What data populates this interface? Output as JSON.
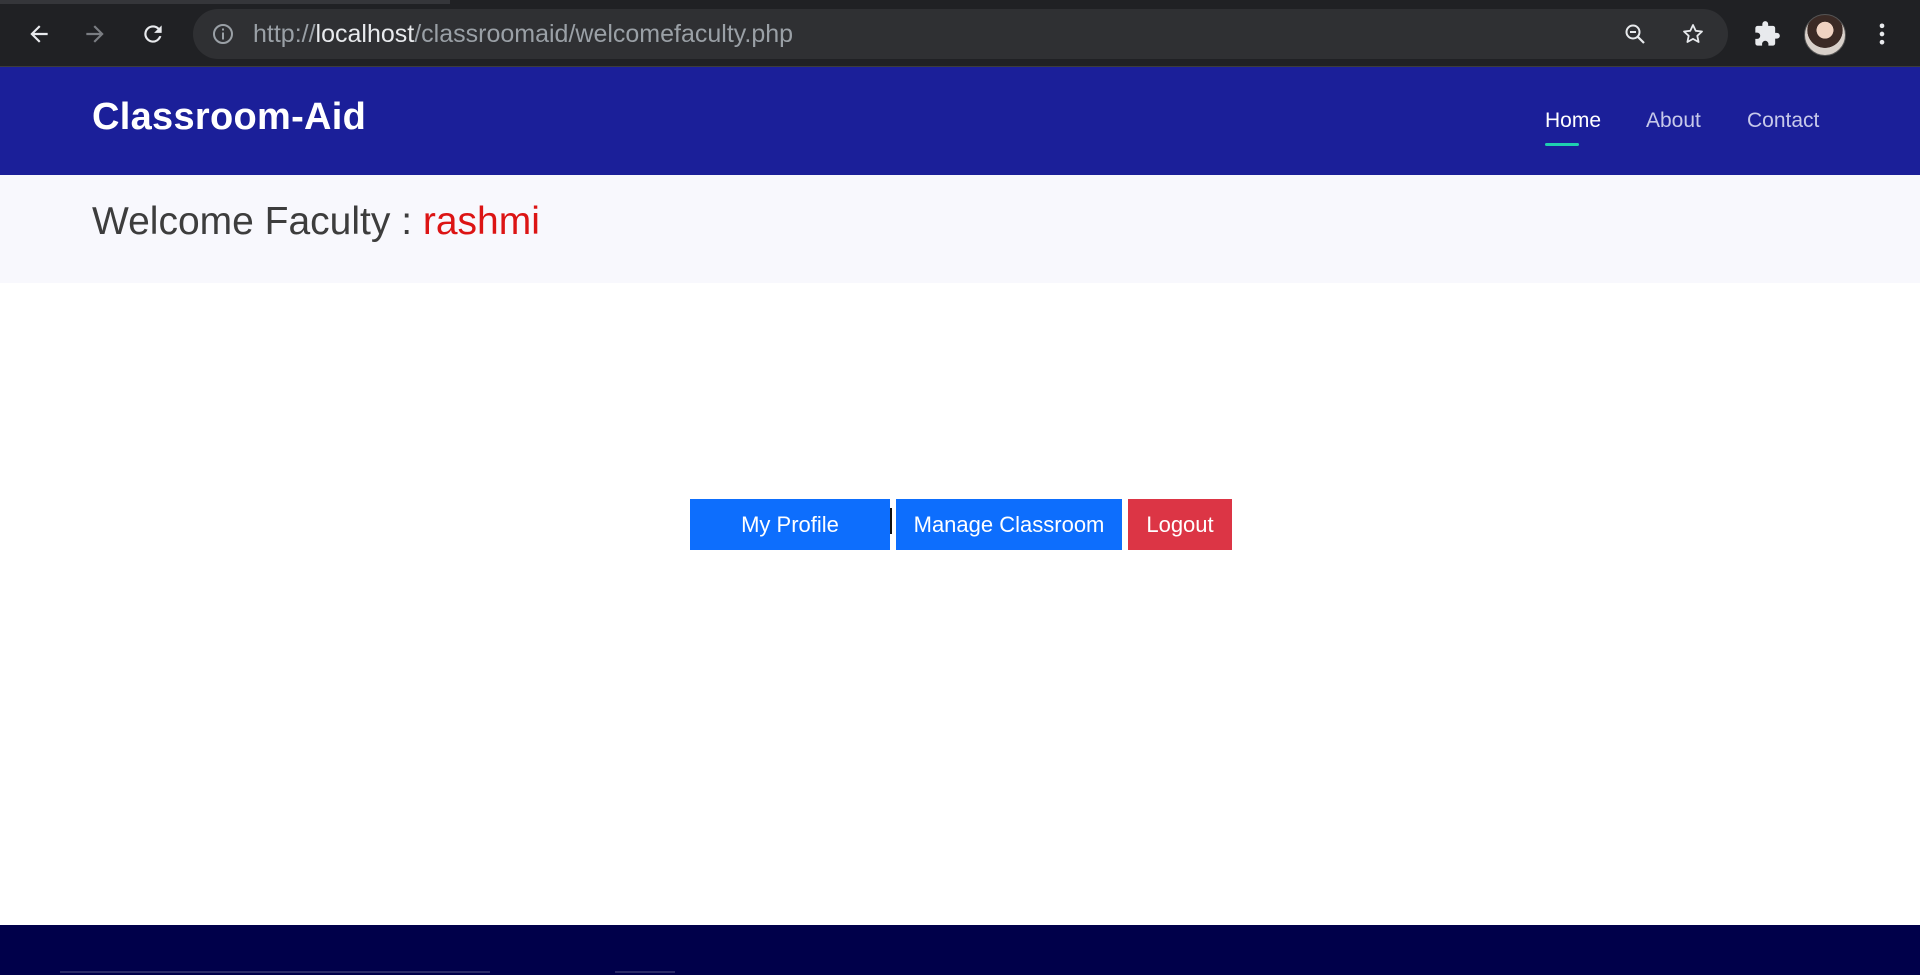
{
  "browser": {
    "url_prefix": "http://",
    "url_host": "localhost",
    "url_path": "/classroomaid/welcomefaculty.php"
  },
  "header": {
    "brand": "Classroom-Aid",
    "nav": [
      {
        "label": "Home",
        "active": true
      },
      {
        "label": "About",
        "active": false
      },
      {
        "label": "Contact",
        "active": false
      }
    ]
  },
  "welcome": {
    "prefix": "Welcome Faculty : ",
    "name": "rashmi"
  },
  "actions": {
    "my_profile": "My Profile",
    "manage_classroom": "Manage Classroom",
    "logout": "Logout"
  },
  "colors": {
    "header_bg": "#1b1f99",
    "nav_active_underline": "#1fd0b0",
    "welcome_name": "#dc1414",
    "primary_button": "#0d6efd",
    "danger_button": "#dc3545",
    "footer_bg": "#00004a"
  },
  "icons": {
    "back": "arrow-left-icon",
    "forward": "arrow-right-icon",
    "reload": "reload-icon",
    "site_info": "info-icon",
    "zoom": "zoom-out-icon",
    "bookmark": "star-icon",
    "extensions": "puzzle-icon",
    "menu": "kebab-menu-icon"
  }
}
